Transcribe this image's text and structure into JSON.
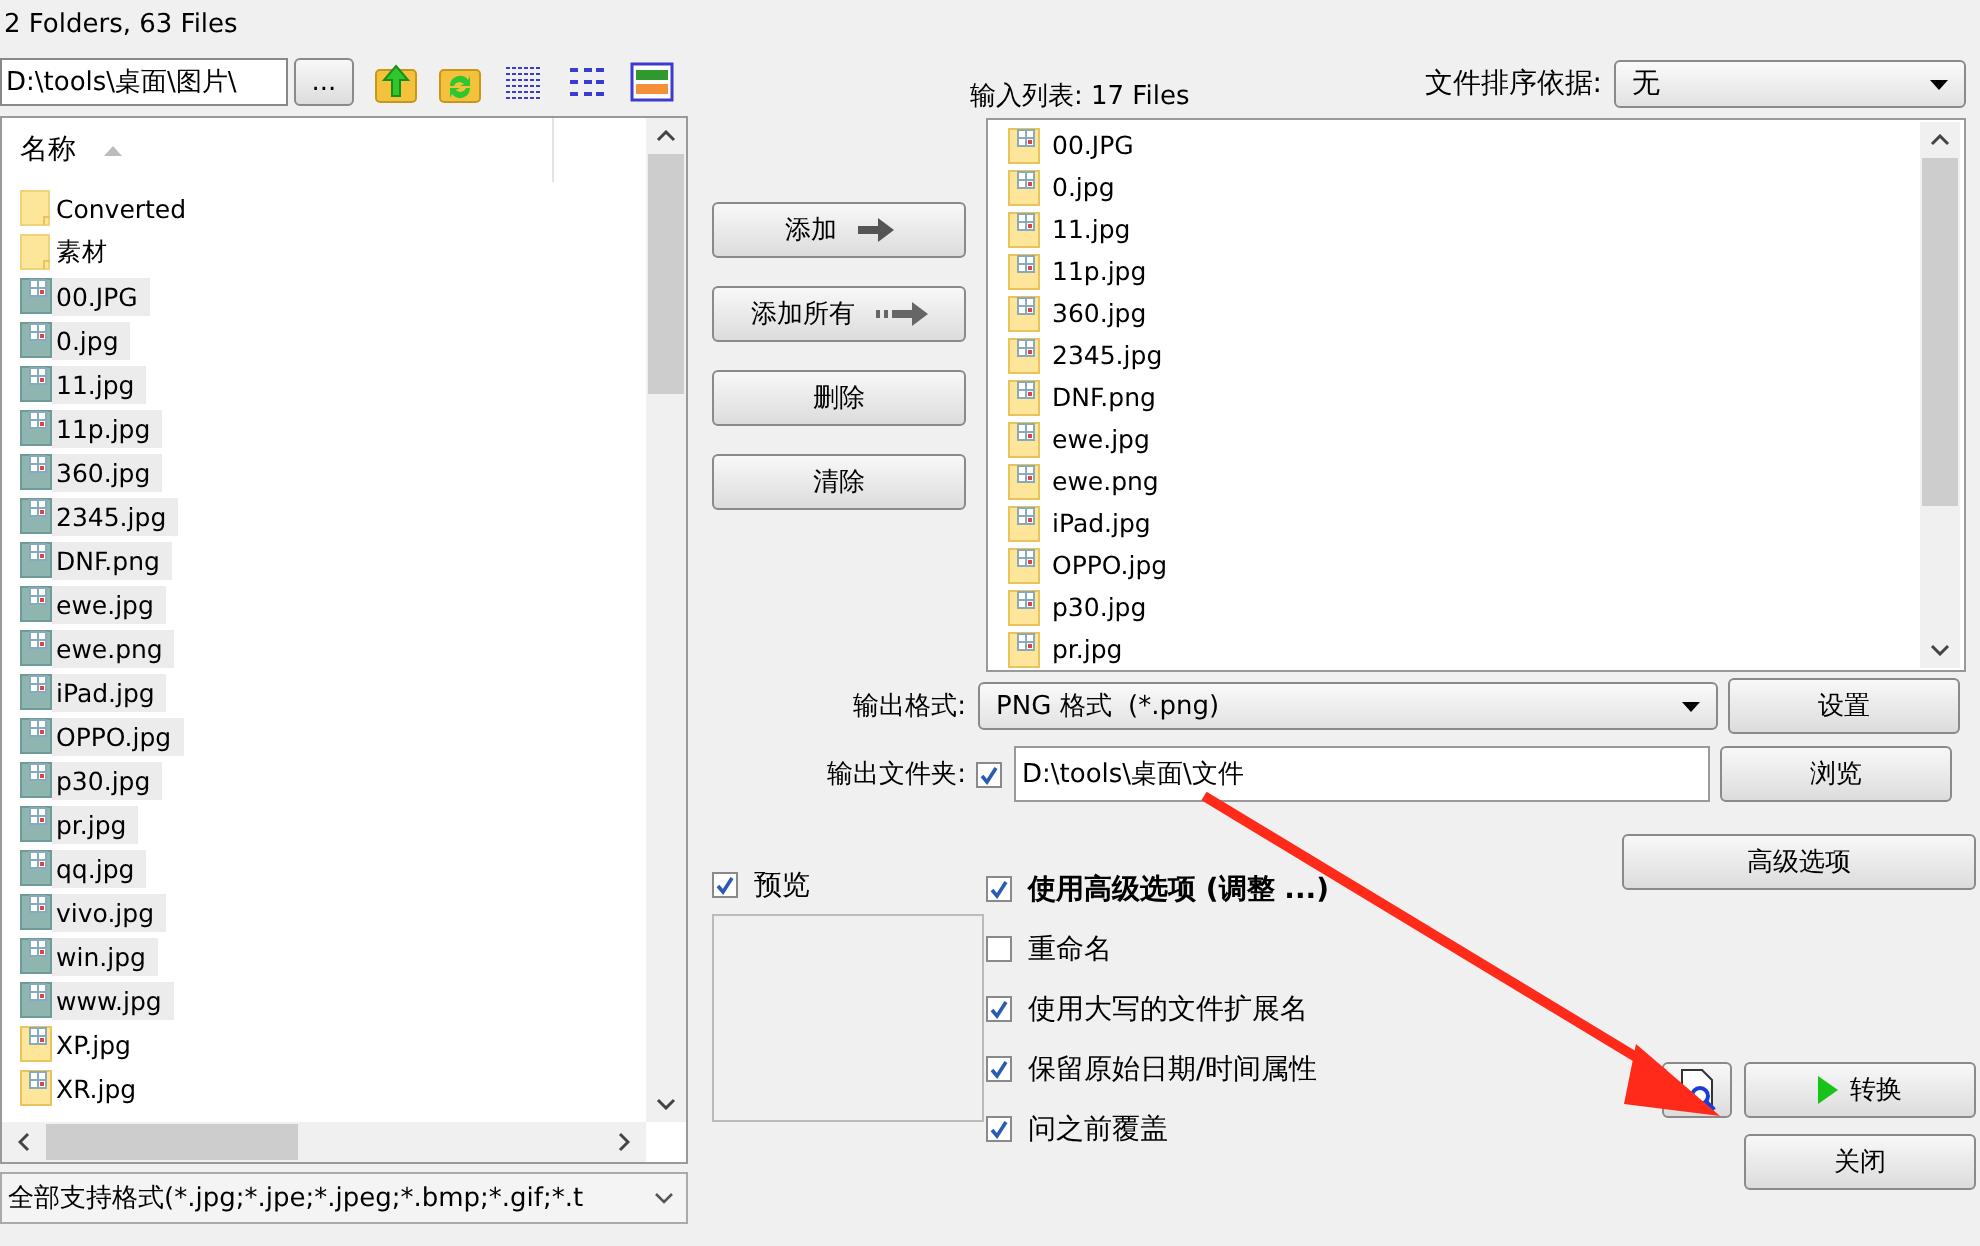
{
  "status": "2 Folders, 63 Files",
  "path_field": {
    "value": "D:\\tools\\桌面\\图片\\",
    "button": "..."
  },
  "file_list": {
    "header": "名称",
    "items": [
      {
        "name": "Converted",
        "kind": "folder",
        "selected": false
      },
      {
        "name": "素材",
        "kind": "folder",
        "selected": false
      },
      {
        "name": "00.JPG",
        "kind": "image",
        "selected": true
      },
      {
        "name": "0.jpg",
        "kind": "image",
        "selected": true
      },
      {
        "name": "11.jpg",
        "kind": "image",
        "selected": true
      },
      {
        "name": "11p.jpg",
        "kind": "image",
        "selected": true
      },
      {
        "name": "360.jpg",
        "kind": "image",
        "selected": true
      },
      {
        "name": "2345.jpg",
        "kind": "image",
        "selected": true
      },
      {
        "name": "DNF.png",
        "kind": "image",
        "selected": true
      },
      {
        "name": "ewe.jpg",
        "kind": "image",
        "selected": true
      },
      {
        "name": "ewe.png",
        "kind": "image",
        "selected": true
      },
      {
        "name": "iPad.jpg",
        "kind": "image",
        "selected": true
      },
      {
        "name": "OPPO.jpg",
        "kind": "image",
        "selected": true
      },
      {
        "name": "p30.jpg",
        "kind": "image",
        "selected": true
      },
      {
        "name": "pr.jpg",
        "kind": "image",
        "selected": true
      },
      {
        "name": "qq.jpg",
        "kind": "image",
        "selected": true
      },
      {
        "name": "vivo.jpg",
        "kind": "image",
        "selected": true
      },
      {
        "name": "win.jpg",
        "kind": "image",
        "selected": true
      },
      {
        "name": "www.jpg",
        "kind": "image",
        "selected": true
      },
      {
        "name": "XP.jpg",
        "kind": "image",
        "selected": false
      },
      {
        "name": "XR.jpg",
        "kind": "image",
        "selected": false
      }
    ]
  },
  "filter_combo": {
    "value": "全部支持格式(*.jpg;*.jpe;*.jpeg;*.bmp;*.gif;*.t"
  },
  "actions": [
    {
      "label": "添加",
      "kind": "arrow"
    },
    {
      "label": "添加所有",
      "kind": "double-arrow"
    },
    {
      "label": "删除",
      "kind": "plain"
    },
    {
      "label": "清除",
      "kind": "plain"
    }
  ],
  "input_list": {
    "label": "输入列表:",
    "count": "17 Files",
    "items": [
      "00.JPG",
      "0.jpg",
      "11.jpg",
      "11p.jpg",
      "360.jpg",
      "2345.jpg",
      "DNF.png",
      "ewe.jpg",
      "ewe.png",
      "iPad.jpg",
      "OPPO.jpg",
      "p30.jpg",
      "pr.jpg"
    ]
  },
  "sort": {
    "label": "文件排序依据:",
    "value": "无"
  },
  "output_format": {
    "label": "输出格式:",
    "value": "PNG 格式  (*.png)",
    "button": "设置"
  },
  "output_folder": {
    "label": "输出文件夹:",
    "checked": true,
    "value": "D:\\tools\\桌面\\文件",
    "button": "浏览"
  },
  "preview": {
    "label": "预览",
    "checked": true
  },
  "options": [
    {
      "label": "使用高级选项 (调整 ...)",
      "checked": true,
      "bold": true
    },
    {
      "label": "重命名",
      "checked": false,
      "bold": false
    },
    {
      "label": "使用大写的文件扩展名",
      "checked": true,
      "bold": false
    },
    {
      "label": "保留原始日期/时间属性",
      "checked": true,
      "bold": false
    },
    {
      "label": "问之前覆盖",
      "checked": true,
      "bold": false
    }
  ],
  "advanced_button": "高级选项",
  "convert_button": "转换",
  "close_button": "关闭"
}
